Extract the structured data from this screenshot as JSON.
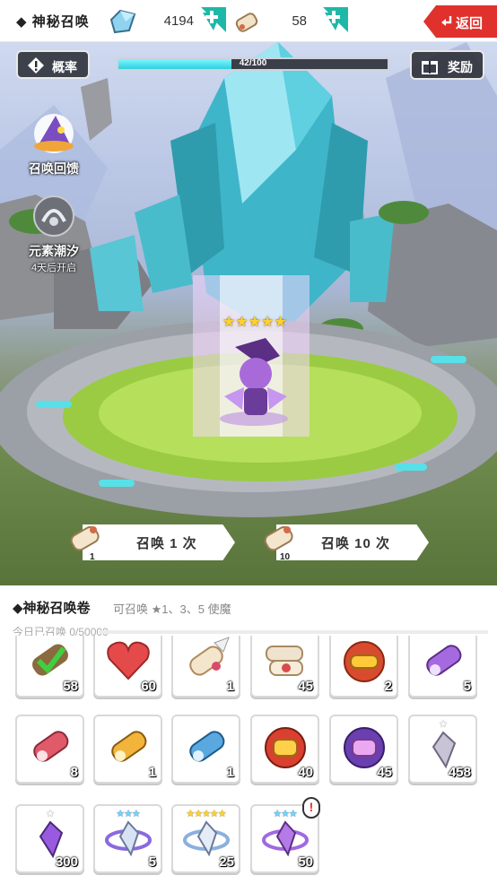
{
  "header": {
    "title": "◆ 神秘召唤",
    "crystal_count": "4194",
    "scroll_count": "58",
    "back_label": "返回"
  },
  "scene": {
    "rate_label": "概率",
    "reward_label": "奖励",
    "progress_text": "42/100",
    "progress_fraction": 0.42,
    "side_items": [
      {
        "label": "召唤回馈",
        "sub": ""
      },
      {
        "label": "元素潮汐",
        "sub": "4天后开启"
      }
    ],
    "hero_stars": "★★★★★"
  },
  "summon": {
    "single_label": "召唤 1 次",
    "single_cost": "1",
    "ten_label": "召唤 10 次",
    "ten_cost": "10"
  },
  "panel": {
    "title": "◆神秘召唤卷",
    "hint": "可召唤 ★1、3、5 使魔",
    "today": "今日已召唤 0/50000",
    "items": [
      {
        "icon": "scroll-check-icon",
        "count": "58",
        "stars": ""
      },
      {
        "icon": "heart-icon",
        "count": "60",
        "stars": ""
      },
      {
        "icon": "winged-scroll-icon",
        "count": "1",
        "stars": ""
      },
      {
        "icon": "scroll-bundle-icon",
        "count": "45",
        "stars": ""
      },
      {
        "icon": "golden-scroll-icon",
        "count": "2",
        "stars": ""
      },
      {
        "icon": "purple-scroll-icon",
        "count": "5",
        "stars": ""
      },
      {
        "icon": "red-scroll-icon",
        "count": "8",
        "stars": ""
      },
      {
        "icon": "yellow-scroll-icon",
        "count": "1",
        "stars": ""
      },
      {
        "icon": "blue-scroll-icon",
        "count": "1",
        "stars": ""
      },
      {
        "icon": "red-orb-scroll-icon",
        "count": "40",
        "stars": ""
      },
      {
        "icon": "purple-orb-scroll-icon",
        "count": "45",
        "stars": ""
      },
      {
        "icon": "silver-shard-icon",
        "count": "458",
        "stars": "★"
      },
      {
        "icon": "purple-shard-icon",
        "count": "300",
        "stars": "★"
      },
      {
        "icon": "blue-ring-shard-icon",
        "count": "5",
        "stars": "★★★"
      },
      {
        "icon": "gold-ring-shard-icon",
        "count": "25",
        "stars": "★★★★★"
      },
      {
        "icon": "purple-ring-shard-icon",
        "count": "50",
        "stars": "★★★"
      }
    ],
    "alert_mark": "!"
  },
  "colors": {
    "accent_red": "#e0312c",
    "progress_cyan": "#2fd0e0",
    "plus_teal": "#1fb8a8"
  }
}
